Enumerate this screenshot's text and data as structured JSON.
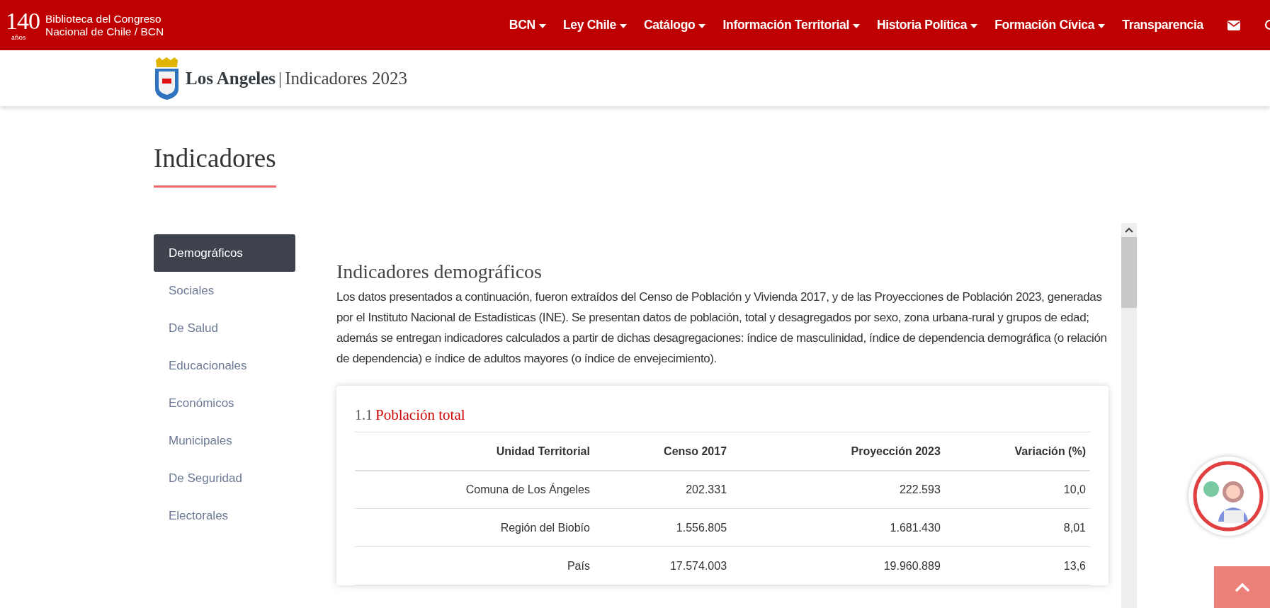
{
  "topbar": {
    "logo": {
      "number": "140",
      "years": "años",
      "line1": "Biblioteca del Congreso",
      "line2": "Nacional de Chile / BCN"
    },
    "menu": [
      {
        "label": "BCN",
        "dropdown": true
      },
      {
        "label": "Ley Chile",
        "dropdown": true
      },
      {
        "label": "Catálogo",
        "dropdown": true
      },
      {
        "label": "Información Territorial",
        "dropdown": true
      },
      {
        "label": "Historia Política",
        "dropdown": true
      },
      {
        "label": "Formación Cívica",
        "dropdown": true
      },
      {
        "label": "Transparencia",
        "dropdown": false
      }
    ]
  },
  "header": {
    "place": "Los Angeles",
    "separator": "|",
    "subtitle": "Indicadores 2023"
  },
  "page_title": "Indicadores",
  "sidebar": {
    "items": [
      {
        "label": "Demográficos",
        "selected": true
      },
      {
        "label": "Sociales",
        "selected": false
      },
      {
        "label": "De Salud",
        "selected": false
      },
      {
        "label": "Educacionales",
        "selected": false
      },
      {
        "label": "Económicos",
        "selected": false
      },
      {
        "label": "Municipales",
        "selected": false
      },
      {
        "label": "De Seguridad",
        "selected": false
      },
      {
        "label": "Electorales",
        "selected": false
      }
    ]
  },
  "section": {
    "title": "Indicadores demográficos",
    "intro": "Los datos presentados a continuación, fueron extraídos del Censo de Población y Vivienda 2017, y de las Proyecciones de Población 2023, generadas por el Instituto Nacional de Estadísticas (INE). Se presentan datos de población, total y desagregados por sexo, zona urbana-rural y grupos de edad; además se entregan indicadores calculados a partir de dichas desagregaciones: índice de masculinidad, índice de dependencia demográfica (o relación de dependencia) e índice de adultos mayores (o índice de envejecimiento)."
  },
  "table_card": {
    "number": "1.1",
    "title": "Población total",
    "columns": [
      "Unidad Territorial",
      "Censo 2017",
      "Proyección 2023",
      "Variación (%)"
    ],
    "rows": [
      [
        "Comuna de Los Ángeles",
        "202.331",
        "222.593",
        "10,0"
      ],
      [
        "Región del Biobío",
        "1.556.805",
        "1.681.430",
        "8,01"
      ],
      [
        "País",
        "17.574.003",
        "19.960.889",
        "13,6"
      ]
    ]
  }
}
